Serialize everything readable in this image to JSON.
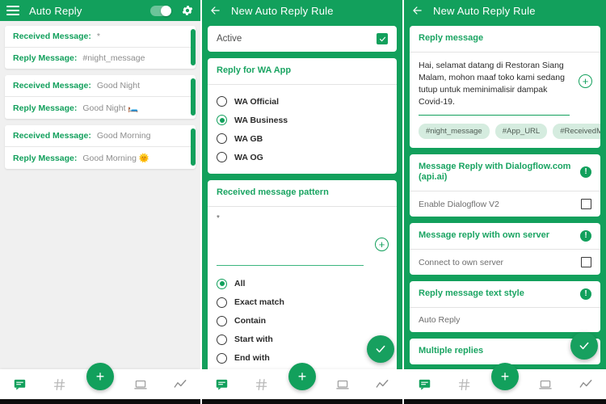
{
  "colors": {
    "brand_green": "#12a05c",
    "accent_green": "#1aa462",
    "chip_bg": "#d5ecdf",
    "page_bg": "#f0f0f0"
  },
  "panel_left": {
    "appbar": {
      "title": "Auto Reply",
      "menu_icon": "hamburger-icon",
      "toggle_state": "on",
      "settings_icon": "gear-icon"
    },
    "rules": [
      {
        "received_label": "Received Message:",
        "received_value": "*",
        "reply_label": "Reply Message:",
        "reply_value": "#night_message"
      },
      {
        "received_label": "Received Message:",
        "received_value": "Good Night",
        "reply_label": "Reply Message:",
        "reply_value": "Good Night 🛏️"
      },
      {
        "received_label": "Received Message:",
        "received_value": "Good Morning",
        "reply_label": "Reply Message:",
        "reply_value": "Good Morning 🌞"
      }
    ]
  },
  "panel_mid": {
    "appbar": {
      "title": "New Auto Reply Rule",
      "back_icon": "back-arrow-icon"
    },
    "active": {
      "label": "Active",
      "checked": true
    },
    "wa_app": {
      "title": "Reply for WA App",
      "options": [
        {
          "label": "WA Official",
          "selected": false
        },
        {
          "label": "WA Business",
          "selected": true
        },
        {
          "label": "WA GB",
          "selected": false
        },
        {
          "label": "WA OG",
          "selected": false
        }
      ]
    },
    "pattern": {
      "title": "Received message pattern",
      "value": "*",
      "add_icon": "plus-circle-icon",
      "match_options": [
        {
          "label": "All",
          "selected": true
        },
        {
          "label": "Exact match",
          "selected": false
        },
        {
          "label": "Contain",
          "selected": false
        },
        {
          "label": "Start with",
          "selected": false
        },
        {
          "label": "End with",
          "selected": false
        }
      ]
    },
    "save_fab": "check-icon"
  },
  "panel_right": {
    "appbar": {
      "title": "New Auto Reply Rule",
      "back_icon": "back-arrow-icon"
    },
    "reply_message": {
      "title": "Reply message",
      "text": "Hai, selamat datang di Restoran Siang Malam, mohon maaf toko kami sedang tutup untuk meminimalisir dampak Covid-19.",
      "add_icon": "plus-circle-icon",
      "chips": [
        "#night_message",
        "#App_URL",
        "#ReceivedMess"
      ]
    },
    "dialogflow": {
      "title": "Message Reply with Dialogflow.com (api.ai)",
      "info_icon": "info-icon",
      "sub_label": "Enable Dialogflow V2",
      "checked": false
    },
    "own_server": {
      "title": "Message reply with own server",
      "info_icon": "info-icon",
      "sub_label": "Connect to own server",
      "checked": false
    },
    "text_style": {
      "title": "Reply message text style",
      "info_icon": "info-icon",
      "sub_label": "Auto Reply"
    },
    "multiple_replies": {
      "title": "Multiple replies"
    },
    "save_fab": "check-icon"
  },
  "bottom_nav": {
    "items": [
      {
        "icon": "message-icon",
        "active": true
      },
      {
        "icon": "hashtag-icon",
        "active": false
      },
      {
        "icon": "laptop-icon",
        "active": false
      },
      {
        "icon": "analytics-icon",
        "active": false
      }
    ],
    "fab": "plus-icon"
  }
}
